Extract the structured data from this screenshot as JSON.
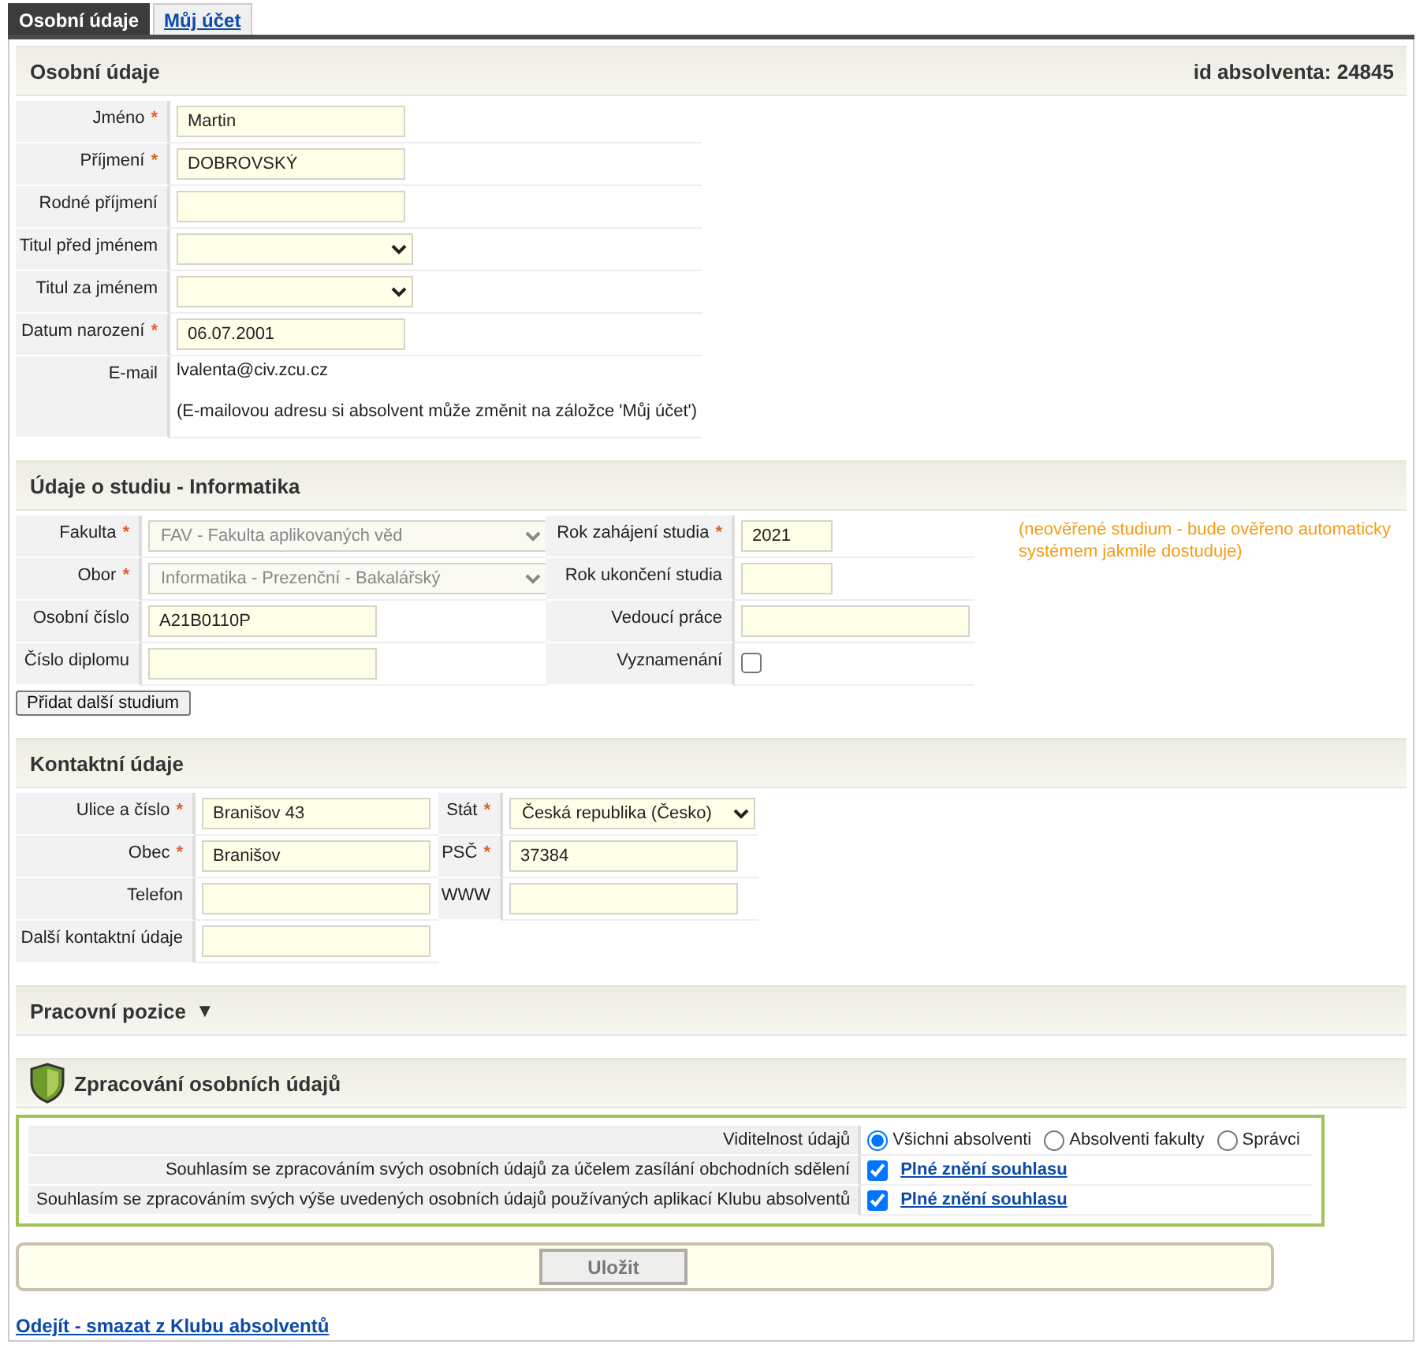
{
  "tabs": [
    {
      "label": "Osobní údaje",
      "selected": true
    },
    {
      "label": "Můj účet",
      "selected": false
    }
  ],
  "required_mark": "*",
  "personal": {
    "title": "Osobní údaje",
    "id_label": "id absolventa: 24845",
    "fields": [
      {
        "kind": "text",
        "label": "Jméno",
        "required": true,
        "value": "Martin"
      },
      {
        "kind": "text",
        "label": "Příjmení",
        "required": true,
        "value": "DOBROVSKÝ"
      },
      {
        "kind": "text",
        "label": "Rodné příjmení",
        "required": false
      },
      {
        "kind": "select",
        "label": "Titul před jménem",
        "required": false
      },
      {
        "kind": "select",
        "label": "Titul za jménem",
        "required": false
      },
      {
        "kind": "text",
        "label": "Datum narození",
        "required": true,
        "value": "06.07.2001"
      },
      {
        "kind": "static",
        "label": "E-mail",
        "required": false,
        "value": "lvalenta@civ.zcu.cz",
        "note": "(E-mailovou adresu si absolvent může změnit na záložce 'Můj účet')"
      }
    ]
  },
  "study": {
    "title": "Údaje o studiu - Informatika",
    "rows": [
      [
        {
          "kind": "select",
          "label": "Fakulta",
          "required": true,
          "value": "FAV - Fakulta aplikovaných věd",
          "disabled": true
        },
        {
          "kind": "year",
          "label": "Rok zahájení studia",
          "required": true,
          "value": "2021"
        }
      ],
      [
        {
          "kind": "select",
          "label": "Obor",
          "required": true,
          "value": "Informatika - Prezenční - Bakalářský",
          "disabled": true
        },
        {
          "kind": "year",
          "label": "Rok ukončení studia",
          "required": false
        }
      ],
      [
        {
          "kind": "text",
          "label": "Osobní číslo",
          "required": false,
          "value": "A21B0110P"
        },
        {
          "kind": "text",
          "label": "Vedoucí práce",
          "required": false
        }
      ],
      [
        {
          "kind": "text",
          "label": "Číslo diplomu",
          "required": false
        },
        {
          "kind": "checkbox",
          "label": "Vyznamenání",
          "required": false,
          "checked": false
        }
      ]
    ],
    "note": "(neověřené studium - bude ověřeno automaticky systémem jakmile dostuduje)",
    "add_button": "Přidat další studium"
  },
  "contact": {
    "title": "Kontaktní údaje",
    "rows": [
      [
        {
          "kind": "text",
          "label": "Ulice a číslo",
          "required": true,
          "value": "Branišov 43"
        },
        {
          "kind": "select",
          "label": "Stát",
          "required": true,
          "value": "Česká republika (Česko)"
        }
      ],
      [
        {
          "kind": "text",
          "label": "Obec",
          "required": true,
          "value": "Branišov"
        },
        {
          "kind": "text",
          "label": "PSČ",
          "required": true,
          "value": "37384"
        }
      ],
      [
        {
          "kind": "text",
          "label": "Telefon",
          "required": false
        },
        {
          "kind": "text",
          "label": "WWW",
          "required": false
        }
      ],
      [
        {
          "kind": "text",
          "label": "Další kontaktní údaje",
          "required": false
        }
      ]
    ]
  },
  "work": {
    "title": "Pracovní pozice",
    "toggle": "▼",
    "expanded": false
  },
  "consent": {
    "title": "Zpracování osobních údajů",
    "visibility": {
      "label": "Viditelnost údajů",
      "options": [
        {
          "label": "Všichni absolventi",
          "selected": true
        },
        {
          "label": "Absolventi fakulty",
          "selected": false
        },
        {
          "label": "Správci",
          "selected": false
        }
      ]
    },
    "agreements": [
      {
        "label": "Souhlasím se zpracováním svých osobních údajů za účelem zasílání obchodních sdělení",
        "checked": true,
        "link": "Plné znění souhlasu"
      },
      {
        "label": "Souhlasím se zpracováním svých výše uvedených osobních údajů používaných aplikací Klubu absolventů",
        "checked": true,
        "link": "Plné znění souhlasu"
      }
    ]
  },
  "save_button": "Uložit",
  "leave_link": "Odejít - smazat z Klubu absolventů"
}
